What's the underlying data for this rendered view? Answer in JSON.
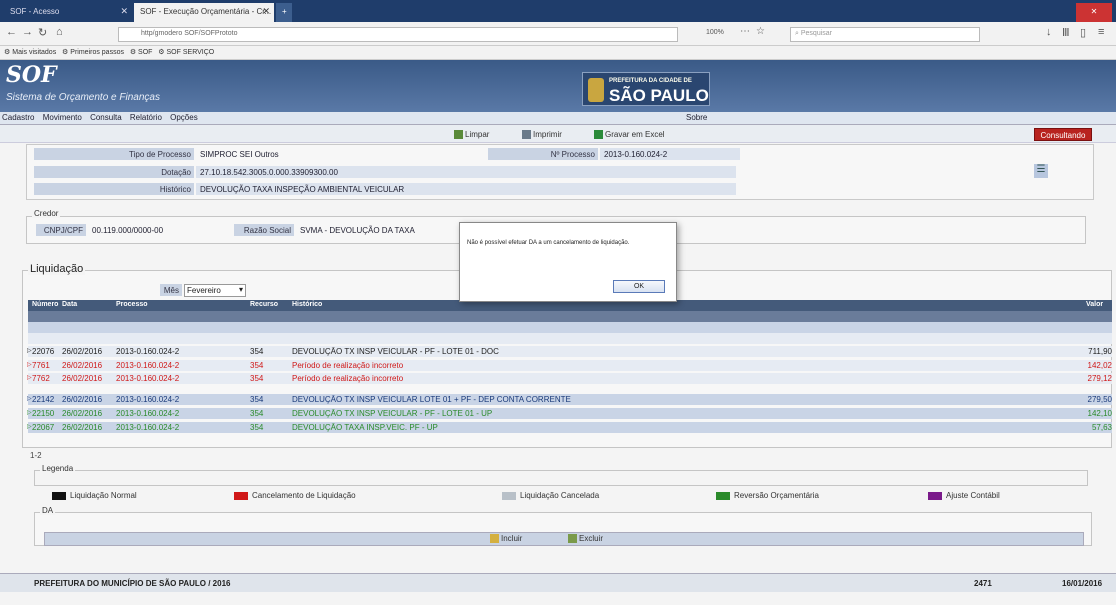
{
  "browser": {
    "tabs": [
      {
        "label": "SOF - Acesso",
        "active": false
      },
      {
        "label": "SOF - Execução Orçamentária - Cr...",
        "active": true
      },
      {
        "label": "",
        "active": false
      }
    ],
    "url": "http/gmodero SOF/SOFPrototo",
    "zoom": "100%",
    "search_placeholder": "Pesquisar",
    "bookmarks": [
      "Mais visitados",
      "Primeiros passos",
      "SOF",
      "SOF SERVIÇO"
    ]
  },
  "app": {
    "logo": "SOF",
    "subtitle": "Sistema de Orçamento e Finanças",
    "city_small": "PREFEITURA DA CIDADE DE",
    "city_big": "SÃO PAULO",
    "menu": [
      "Cadastro",
      "Movimento",
      "Consulta",
      "Relatório",
      "Opções"
    ],
    "menu_right": "Sobre"
  },
  "toolbar": {
    "limpar": "Limpar",
    "imprimir": "Imprimir",
    "gravar": "Gravar em Excel",
    "consultando": "Consultando"
  },
  "processo": {
    "tipo_label": "Tipo de Processo",
    "tipo_value": "SIMPROC   SEI   Outros",
    "numero_label": "Nº Processo",
    "numero_value": "2013-0.160.024-2",
    "dotacao_label": "Dotação",
    "dotacao_value": "27.10.18.542.3005.0.000.33909300.00",
    "historico_label": "Histórico",
    "historico_value": "DEVOLUÇÃO TAXA INSPEÇÃO AMBIENTAL VEICULAR"
  },
  "credor": {
    "title": "Credor",
    "cnpj_label": "CNPJ/CPF",
    "cnpj_value": "00.119.000/0000-00",
    "razao_label": "Razão Social",
    "razao_value": "SVMA - DEVOLUÇÃO DA TAXA"
  },
  "liquidacao": {
    "title": "Liquidação",
    "mes_label": "Mês",
    "mes_value": "Fevereiro",
    "columns": [
      "Número",
      "Data",
      "Processo",
      "Recurso",
      "Histórico",
      "Valor"
    ],
    "rows": [
      {
        "numero": "",
        "data": "",
        "processo": "",
        "recurso": "",
        "historico": "",
        "valor": "",
        "style": "dark",
        "color": "c-black"
      },
      {
        "numero": "",
        "data": "",
        "processo": "",
        "recurso": "",
        "historico": "",
        "valor": "",
        "style": "light",
        "color": "c-black"
      },
      {
        "numero": "",
        "data": "",
        "processo": "",
        "recurso": "",
        "historico": "",
        "valor": "",
        "style": "alt",
        "color": "c-black"
      },
      {
        "numero": "22076",
        "data": "26/02/2016",
        "processo": "2013-0.160.024-2",
        "recurso": "354",
        "historico": "DEVOLUÇÃO TX INSP VEICULAR - PF - LOTE 01 - DOC",
        "valor": "711,90",
        "style": "alt",
        "color": "c-black"
      },
      {
        "numero": "7761",
        "data": "26/02/2016",
        "processo": "2013-0.160.024-2",
        "recurso": "354",
        "historico": "Período de realização incorreto",
        "valor": "142,02",
        "style": "alt",
        "color": "c-red"
      },
      {
        "numero": "7762",
        "data": "26/02/2016",
        "processo": "2013-0.160.024-2",
        "recurso": "354",
        "historico": "Período de realização incorreto",
        "valor": "279,12",
        "style": "alt",
        "color": "c-red"
      },
      {
        "numero": "22142",
        "data": "26/02/2016",
        "processo": "2013-0.160.024-2",
        "recurso": "354",
        "historico": "DEVOLUÇÃO TX INSP VEICULAR LOTE 01 + PF - DEP CONTA CORRENTE",
        "valor": "279,50",
        "style": "light",
        "color": "c-blue"
      },
      {
        "numero": "22150",
        "data": "26/02/2016",
        "processo": "2013-0.160.024-2",
        "recurso": "354",
        "historico": "DEVOLUÇÃO TX INSP VEICULAR - PF - LOTE 01 - UP",
        "valor": "142,10",
        "style": "light",
        "color": "c-green"
      },
      {
        "numero": "22067",
        "data": "26/02/2016",
        "processo": "2013-0.160.024-2",
        "recurso": "354",
        "historico": "DEVOLUÇÃO TAXA INSP.VEIC. PF - UP",
        "valor": "57,63",
        "style": "light",
        "color": "c-green"
      }
    ],
    "row_count": "1-2"
  },
  "legenda": {
    "title": "Legenda",
    "items": [
      {
        "label": "Liquidação Normal",
        "color": "#111111"
      },
      {
        "label": "Cancelamento de Liquidação",
        "color": "#d01818"
      },
      {
        "label": "Liquidação Cancelada",
        "color": "#b8c0c8"
      },
      {
        "label": "Reversão Orçamentária",
        "color": "#2a8a2a"
      },
      {
        "label": "Ajuste Contábil",
        "color": "#7a1a8a"
      }
    ]
  },
  "da": {
    "title": "DA",
    "incluir": "Incluir",
    "excluir": "Excluir"
  },
  "footer": {
    "left": "PREFEITURA DO MUNICÍPIO DE SÃO PAULO / 2016",
    "code": "2471",
    "date": "16/01/2016"
  },
  "dialog": {
    "message": "Não é possível efetuar DA a um cancelamento de liquidação.",
    "ok": "OK"
  }
}
